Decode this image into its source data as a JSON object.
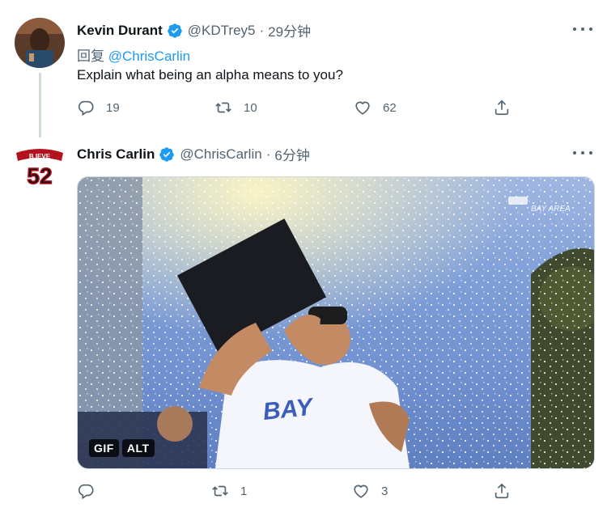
{
  "tweet1": {
    "name": "Kevin Durant",
    "handle": "@KDTrey5",
    "time": "29分钟",
    "reply_prefix": "回复",
    "reply_to": "@ChrisCarlin",
    "text": "Explain what being an alpha means to you?",
    "replies": "19",
    "retweets": "10",
    "likes": "62"
  },
  "tweet2": {
    "name": "Chris Carlin",
    "handle": "@ChrisCarlin",
    "time": "6分钟",
    "avatar_text_top": "B IEVE",
    "avatar_number": "52",
    "media": {
      "watermark": "BAY AREA",
      "gif_label": "GIF",
      "alt_label": "ALT"
    },
    "replies": "",
    "retweets": "1",
    "likes": "3"
  },
  "colors": {
    "accent": "#1d9bf0",
    "muted": "#536471",
    "text": "#0f1419"
  }
}
